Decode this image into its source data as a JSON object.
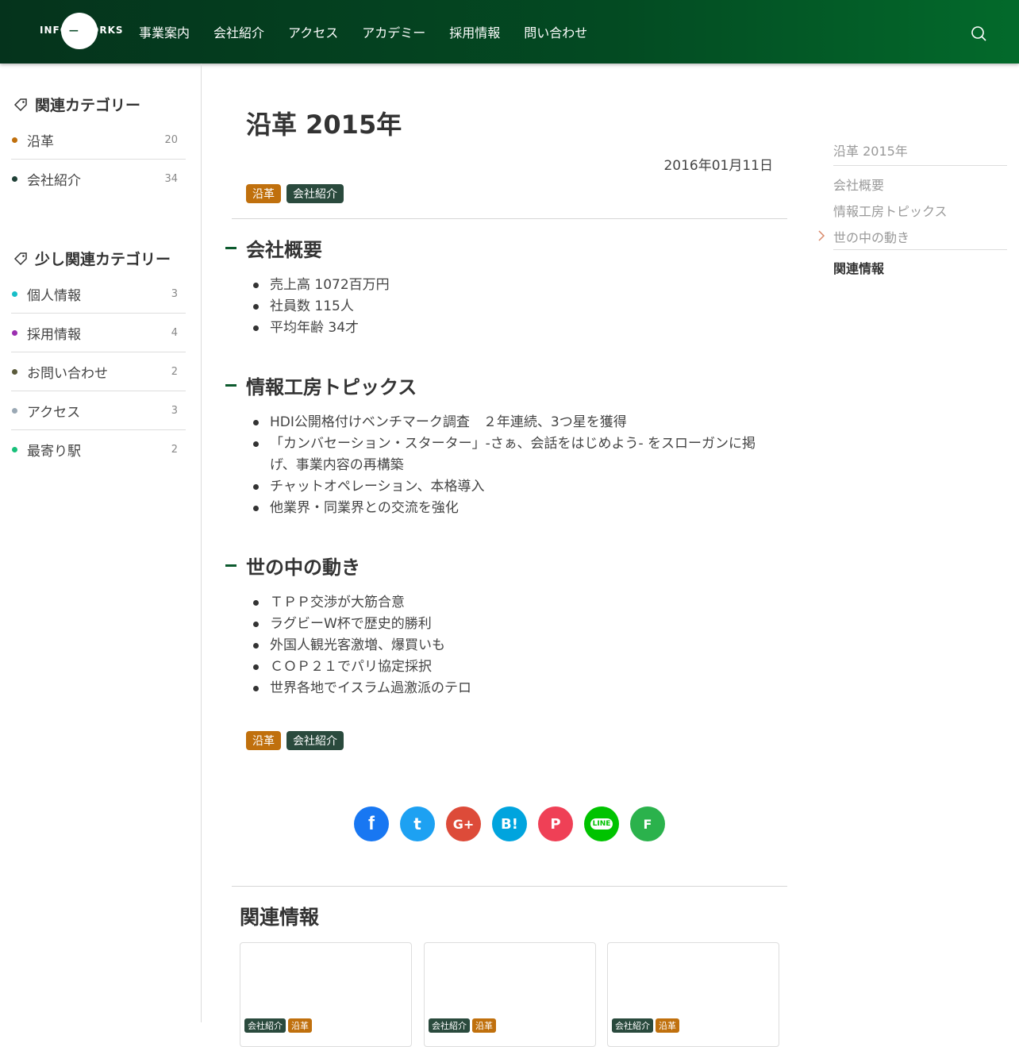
{
  "header": {
    "logo_left": "INFO",
    "logo_right": "WORKS",
    "nav": [
      "事業案内",
      "会社紹介",
      "アクセス",
      "アカデミー",
      "採用情報",
      "問い合わせ"
    ]
  },
  "sidebar": {
    "related_heading": "関連カテゴリー",
    "related": [
      {
        "label": "沿革",
        "count": "20",
        "color": "#c0700d"
      },
      {
        "label": "会社紹介",
        "count": "34",
        "color": "#1f4036"
      }
    ],
    "some_heading": "少し関連カテゴリー",
    "some": [
      {
        "label": "個人情報",
        "count": "3",
        "color": "#17bec8"
      },
      {
        "label": "採用情報",
        "count": "4",
        "color": "#9b2fb0"
      },
      {
        "label": "お問い合わせ",
        "count": "2",
        "color": "#5b5b3c"
      },
      {
        "label": "アクセス",
        "count": "3",
        "color": "#9aa8b4"
      },
      {
        "label": "最寄り駅",
        "count": "2",
        "color": "#18c07a"
      }
    ]
  },
  "article": {
    "title": "沿革 2015年",
    "date": "2016年01月11日",
    "tags": [
      "沿革",
      "会社紹介"
    ],
    "sections": [
      {
        "heading": "会社概要",
        "items": [
          "売上高 1072百万円",
          "社員数 115人",
          "平均年齢 34才"
        ]
      },
      {
        "heading": "情報工房トピックス",
        "items": [
          "HDI公開格付けベンチマーク調査　２年連続、3つ星を獲得",
          "「カンバセーション・スターター」-さぁ、会話をはじめよう- をスローガンに掲げ、事業内容の再構築",
          "チャットオペレーション、本格導入",
          "他業界・同業界との交流を強化"
        ]
      },
      {
        "heading": "世の中の動き",
        "items": [
          "ＴＰＰ交渉が大筋合意",
          "ラグビーW杯で歴史的勝利",
          "外国人観光客激増、爆買いも",
          "ＣＯＰ２１でパリ協定採択",
          "世界各地でイスラム過激派のテロ"
        ]
      }
    ],
    "share": {
      "facebook": "f",
      "twitter": "t",
      "googleplus": "G+",
      "hatena": "B!",
      "pocket": "P",
      "line": "LINE",
      "feedly": "F",
      "colors": {
        "facebook": "#1877f2",
        "twitter": "#1da1f2",
        "googleplus": "#dd4b39",
        "hatena": "#00a4de",
        "pocket": "#ef4056",
        "line": "#00c300",
        "feedly": "#2bb24c"
      }
    },
    "related_heading": "関連情報",
    "cards": [
      {
        "tags": [
          "会社紹介",
          "沿革"
        ]
      },
      {
        "tags": [
          "会社紹介",
          "沿革"
        ]
      },
      {
        "tags": [
          "会社紹介",
          "沿革"
        ]
      }
    ]
  },
  "toc": {
    "main": "沿革 2015年",
    "items": [
      "会社概要",
      "情報工房トピックス",
      "世の中の動き"
    ],
    "related": "関連情報"
  }
}
